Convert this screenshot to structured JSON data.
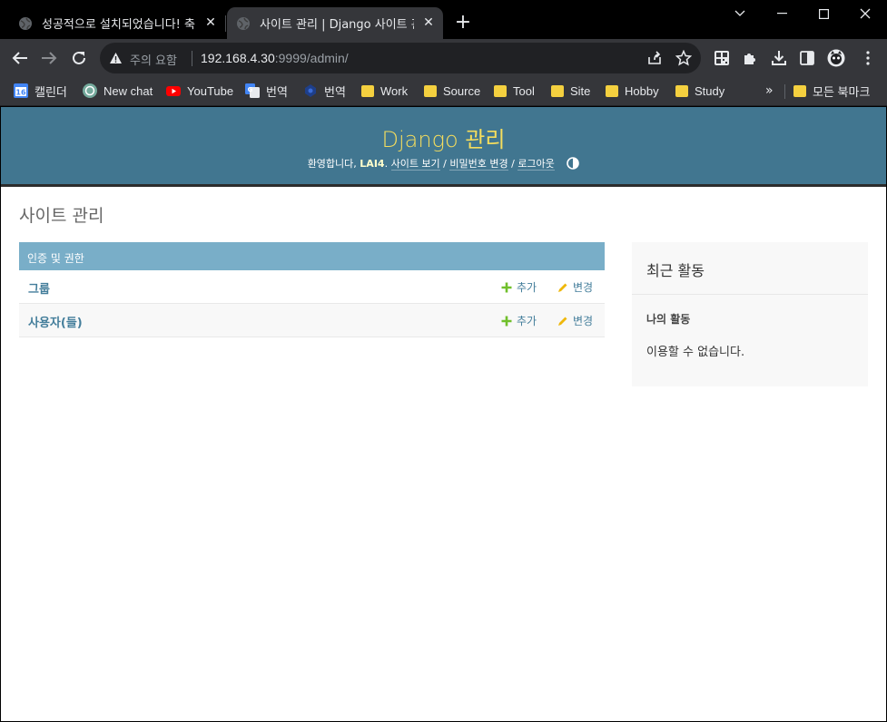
{
  "browser": {
    "tabs": [
      {
        "title": "성공적으로 설치되었습니다! 축",
        "active": false
      },
      {
        "title": "사이트 관리 | Django 사이트 관",
        "active": true
      }
    ],
    "omnibox": {
      "security_label": "주의 요함",
      "url_host": "192.168.4.30",
      "url_rest": ":9999/admin/"
    },
    "bookmarks": [
      {
        "label": "캘린더",
        "icon": "calendar-icon"
      },
      {
        "label": "New chat",
        "icon": "chatgpt-icon"
      },
      {
        "label": "YouTube",
        "icon": "youtube-icon"
      },
      {
        "label": "번역",
        "icon": "google-translate-icon"
      },
      {
        "label": "번역",
        "icon": "papago-icon"
      },
      {
        "label": "Work",
        "icon": "folder-icon"
      },
      {
        "label": "Source",
        "icon": "folder-icon"
      },
      {
        "label": "Tool",
        "icon": "folder-icon"
      },
      {
        "label": "Site",
        "icon": "folder-icon"
      },
      {
        "label": "Hobby",
        "icon": "folder-icon"
      },
      {
        "label": "Study",
        "icon": "folder-icon"
      }
    ],
    "bookmarks_more": "»",
    "all_bookmarks": "모든 북마크"
  },
  "header": {
    "site_name": "Django 관리",
    "welcome": "환영합니다,",
    "username": "LAI4",
    "view_site": "사이트 보기",
    "change_password": "비밀번호 변경",
    "logout": "로그아웃",
    "separator": " / "
  },
  "main": {
    "title": "사이트 관리",
    "module": {
      "caption": "인증 및 권한",
      "models": [
        {
          "name": "그룹",
          "add": "추가",
          "change": "변경"
        },
        {
          "name": "사용자(들)",
          "add": "추가",
          "change": "변경"
        }
      ]
    }
  },
  "recent": {
    "title": "최근 활동",
    "my_actions": "나의 활동",
    "none": "이용할 수 없습니다."
  },
  "colors": {
    "header_bg": "#417690",
    "site_name": "#f5dd5d",
    "caption_bg": "#79aec8",
    "link": "#447e9b",
    "add_icon": "#70bf2b",
    "change_icon": "#efb80b"
  }
}
